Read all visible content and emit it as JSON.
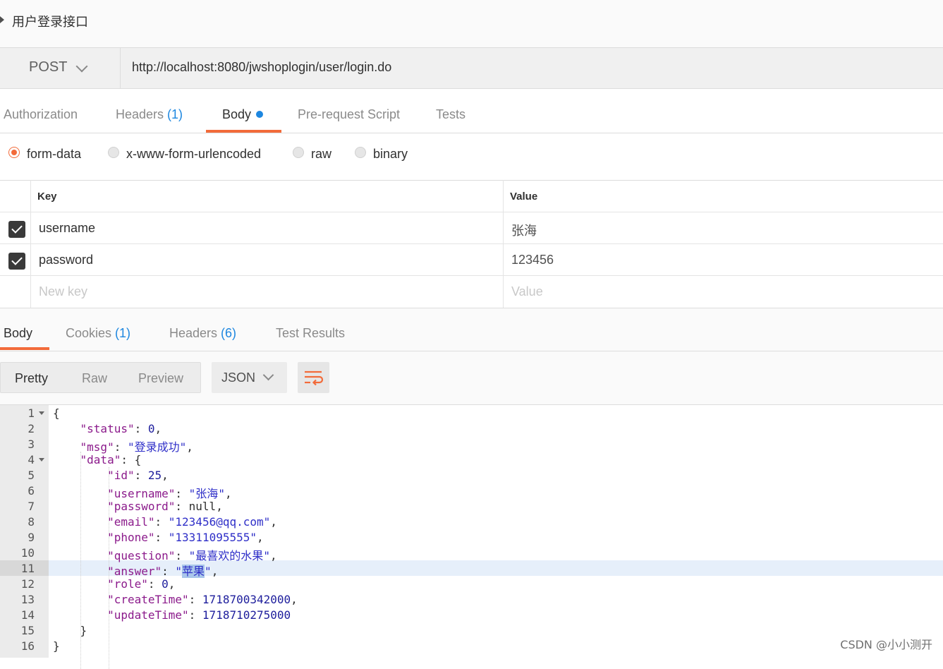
{
  "request": {
    "title": "用户登录接口",
    "method": "POST",
    "url": "http://localhost:8080/jwshoplogin/user/login.do",
    "tabs": [
      {
        "label": "Authorization",
        "count": ""
      },
      {
        "label": "Headers ",
        "count": "(1)"
      },
      {
        "label": "Body",
        "count": ""
      },
      {
        "label": "Pre-request Script",
        "count": ""
      },
      {
        "label": "Tests",
        "count": ""
      }
    ],
    "active_tab": "Body",
    "body_types": [
      "form-data",
      "x-www-form-urlencoded",
      "raw",
      "binary"
    ],
    "selected_body_type": "form-data",
    "table": {
      "key_header": "Key",
      "value_header": "Value",
      "rows": [
        {
          "key": "username",
          "value": "张海",
          "checked": true
        },
        {
          "key": "password",
          "value": "123456",
          "checked": true
        }
      ],
      "new_key_placeholder": "New key",
      "new_value_placeholder": "Value"
    }
  },
  "response": {
    "tabs": [
      {
        "label": "Body",
        "count": ""
      },
      {
        "label": "Cookies ",
        "count": "(1)"
      },
      {
        "label": "Headers ",
        "count": "(6)"
      },
      {
        "label": "Test Results",
        "count": ""
      }
    ],
    "active_tab": "Body",
    "view_modes": [
      "Pretty",
      "Raw",
      "Preview"
    ],
    "active_view": "Pretty",
    "format": "JSON",
    "line_numbers": [
      "1",
      "2",
      "3",
      "4",
      "5",
      "6",
      "7",
      "8",
      "9",
      "10",
      "11",
      "12",
      "13",
      "14",
      "15",
      "16"
    ],
    "json": {
      "status": "0",
      "msg": "登录成功",
      "id": "25",
      "username": "张海",
      "password": "null",
      "email": "123456@qq.com",
      "phone": "13311095555",
      "question": "最喜欢的水果",
      "answer": "苹果",
      "role": "0",
      "createTime": "1718700342000",
      "updateTime": "1718710275000"
    }
  },
  "watermark": "CSDN @小小测开",
  "colors": {
    "accent": "#f26b3a",
    "link_blue": "#1d87e0"
  }
}
